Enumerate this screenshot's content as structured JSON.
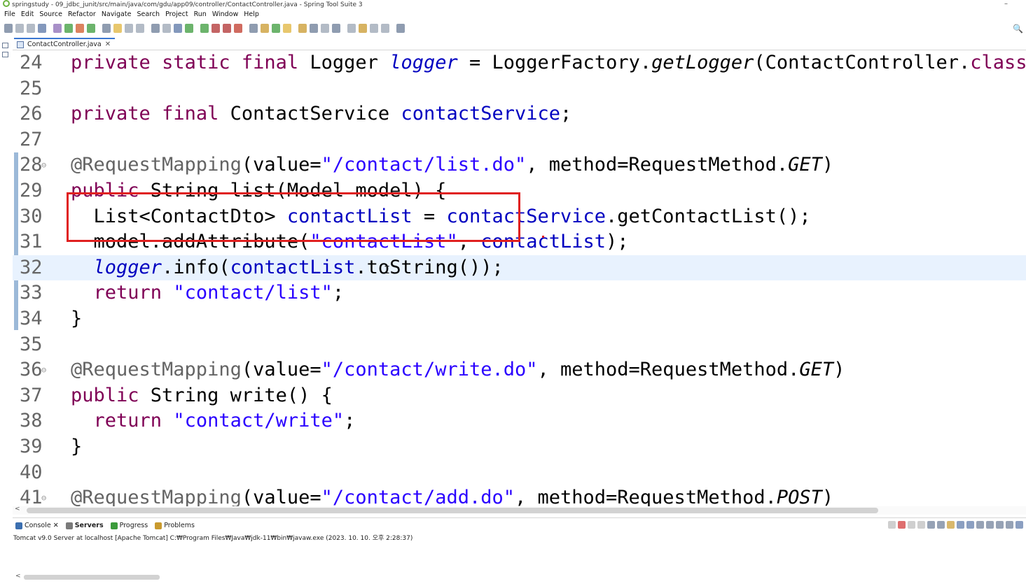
{
  "window": {
    "title": "springstudy - 09_jdbc_junit/src/main/java/com/gdu/app09/controller/ContactController.java - Spring Tool Suite 3",
    "minimize_glyph": "–"
  },
  "menubar": {
    "items": [
      "File",
      "Edit",
      "Source",
      "Refactor",
      "Navigate",
      "Search",
      "Project",
      "Run",
      "Window",
      "Help"
    ]
  },
  "toolbar": {
    "search_icon": "🔍"
  },
  "editor": {
    "tab": {
      "label": "ContactController.java",
      "close": "✕"
    },
    "current_line": 32,
    "lines": [
      {
        "num": "24",
        "fold": "",
        "text": "private static final Logger logger = LoggerFactory.getLogger(ContactController.class);"
      },
      {
        "num": "25",
        "fold": "",
        "text": ""
      },
      {
        "num": "26",
        "fold": "",
        "text": "private final ContactService contactService;"
      },
      {
        "num": "27",
        "fold": "",
        "text": ""
      },
      {
        "num": "28",
        "fold": "⊖",
        "text": "@RequestMapping(value=\"/contact/list.do\", method=RequestMethod.GET)"
      },
      {
        "num": "29",
        "fold": "",
        "text": "public String list(Model model) {"
      },
      {
        "num": "30",
        "fold": "",
        "text": "  List<ContactDto> contactList = contactService.getContactList();"
      },
      {
        "num": "31",
        "fold": "",
        "text": "  model.addAttribute(\"contactList\", contactList);"
      },
      {
        "num": "32",
        "fold": "",
        "text": "  logger.info(contactList.toString());"
      },
      {
        "num": "33",
        "fold": "",
        "text": "  return \"contact/list\";"
      },
      {
        "num": "34",
        "fold": "",
        "text": "}"
      },
      {
        "num": "35",
        "fold": "",
        "text": ""
      },
      {
        "num": "36",
        "fold": "⊖",
        "text": "@RequestMapping(value=\"/contact/write.do\", method=RequestMethod.GET)"
      },
      {
        "num": "37",
        "fold": "",
        "text": "public String write() {"
      },
      {
        "num": "38",
        "fold": "",
        "text": "  return \"contact/write\";"
      },
      {
        "num": "39",
        "fold": "",
        "text": "}"
      },
      {
        "num": "40",
        "fold": "",
        "text": ""
      },
      {
        "num": "41",
        "fold": "⊖",
        "text": "@RequestMapping(value=\"/contact/add.do\", method=RequestMethod.POST)"
      }
    ]
  },
  "bottom_panel": {
    "tabs": [
      {
        "label": "Console",
        "close": "✕",
        "icon_color": "#3c6fb0"
      },
      {
        "label": "Servers",
        "close": "",
        "icon_color": "#7a7a7a"
      },
      {
        "label": "Progress",
        "close": "",
        "icon_color": "#3b9b3b"
      },
      {
        "label": "Problems",
        "close": "",
        "icon_color": "#c99a2e"
      }
    ],
    "console_text": "Tomcat v9.0 Server at localhost [Apache Tomcat] C:₩Program Files₩Java₩jdk-11₩bin₩javaw.exe  (2023. 10. 10. 오후 2:28:37)"
  },
  "colors": {
    "keyword": "#7f0055",
    "field": "#0000c0",
    "string": "#2a00ff",
    "annotation": "#646464",
    "highlight_box": "#e02020",
    "current_line_bg": "#e8f2fe"
  }
}
